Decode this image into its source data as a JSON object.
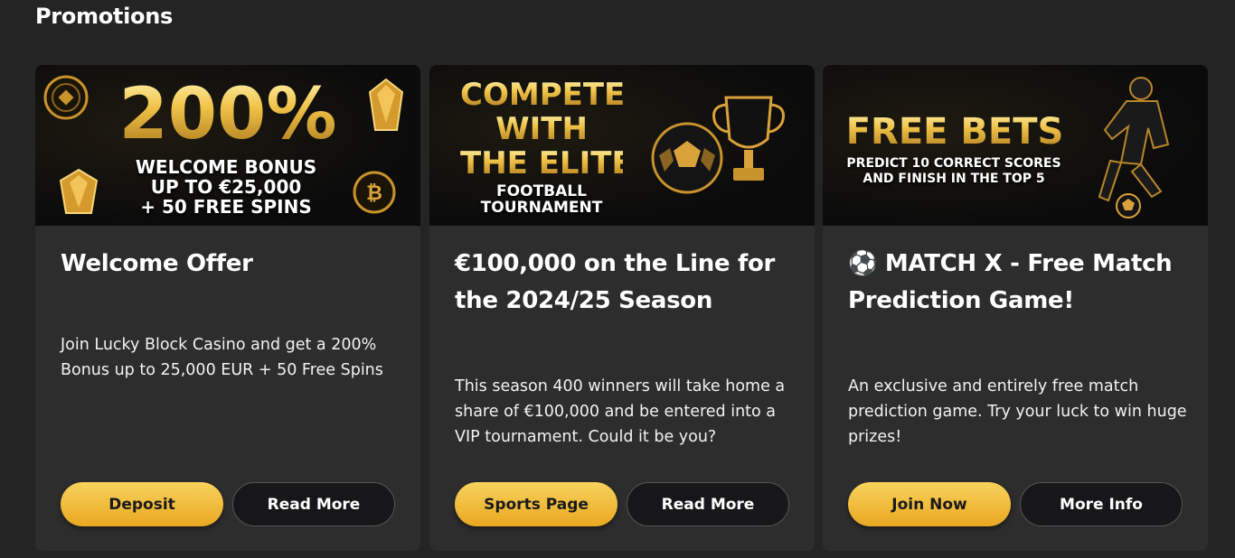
{
  "page": {
    "title": "Promotions"
  },
  "colors": {
    "background": "#242424",
    "card": "#2d2d2d",
    "accent_gold": "#f0c348"
  },
  "cards": [
    {
      "banner": {
        "headline": "200%",
        "line1": "WELCOME BONUS",
        "line2": "UP TO €25,000",
        "line3": "+ 50 FREE SPINS"
      },
      "title": "Welcome Offer",
      "description": "Join Lucky Block Casino and get a 200% Bonus up to 25,000 EUR + 50 Free Spins",
      "primary_label": "Deposit",
      "secondary_label": "Read More"
    },
    {
      "banner": {
        "line1": "COMPETE",
        "line2": "WITH",
        "line3": "THE ELITE",
        "line4": "FOOTBALL",
        "line5": "TOURNAMENT"
      },
      "title": "€100,000 on the Line for the 2024/25 Season",
      "description": "This season 400 winners will take home a share of €100,000 and be entered into a VIP tournament. Could it be you?",
      "primary_label": "Sports Page",
      "secondary_label": "Read More"
    },
    {
      "banner": {
        "headline": "FREE BETS",
        "line1": "PREDICT 10 CORRECT SCORES",
        "line2": "AND FINISH IN THE TOP 5"
      },
      "title_icon": "⚽",
      "title": "MATCH X - Free Match Prediction Game!",
      "description": "An exclusive and entirely free match prediction game. Try your luck to win huge prizes!",
      "primary_label": "Join Now",
      "secondary_label": "More Info"
    }
  ]
}
